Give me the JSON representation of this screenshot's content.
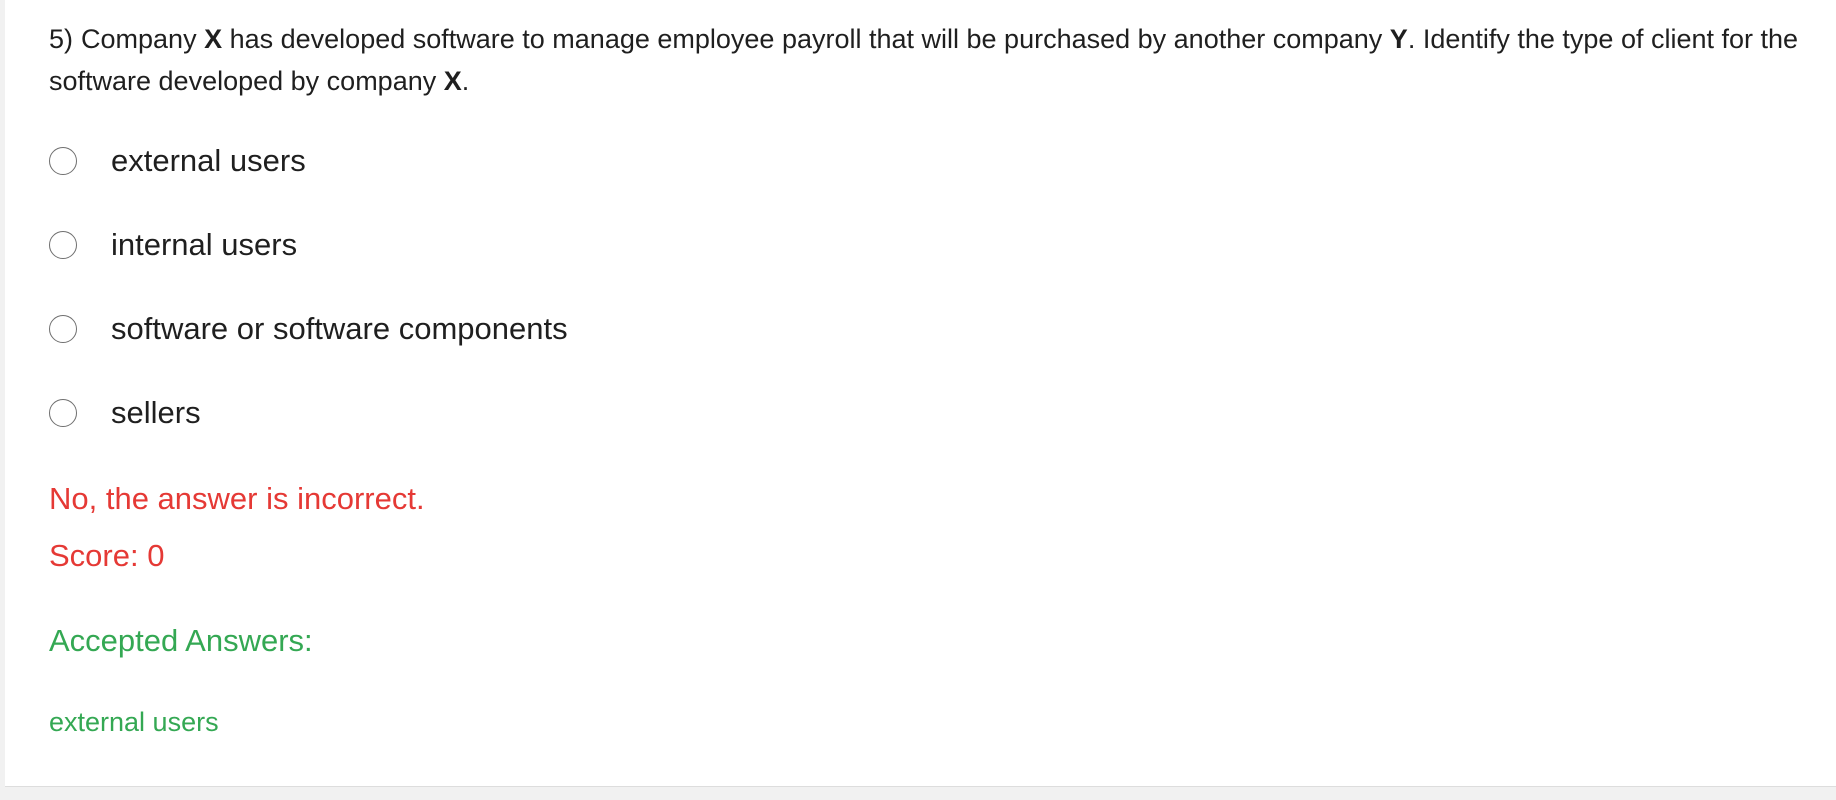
{
  "question": {
    "number": "5)",
    "parts": [
      {
        "text": "Company ",
        "bold": false
      },
      {
        "text": "X",
        "bold": true
      },
      {
        "text": " has developed software to manage employee payroll that will be purchased by another company ",
        "bold": false
      },
      {
        "text": "Y",
        "bold": true
      },
      {
        "text": ". Identify the type of client for the software developed by company ",
        "bold": false
      },
      {
        "text": "X",
        "bold": true
      },
      {
        "text": ".",
        "bold": false
      }
    ]
  },
  "options": [
    {
      "label": "external users"
    },
    {
      "label": "internal users"
    },
    {
      "label": "software or software components"
    },
    {
      "label": "sellers"
    }
  ],
  "feedback": {
    "result": "No, the answer is incorrect.",
    "score": "Score: 0",
    "error_color": "#e53935"
  },
  "accepted": {
    "heading": "Accepted Answers:",
    "answers": [
      "external users"
    ],
    "color": "#34a853"
  }
}
